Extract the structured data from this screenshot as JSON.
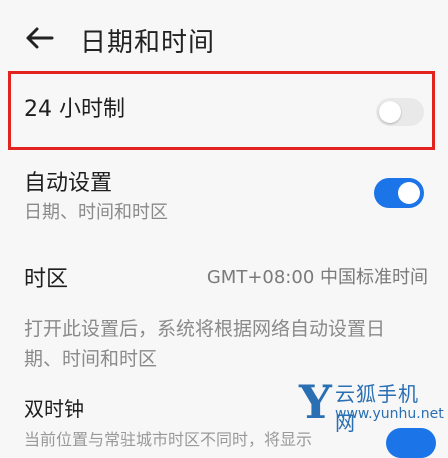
{
  "header": {
    "title": "日期和时间"
  },
  "settings": {
    "time_format_24h": {
      "label": "24 小时制",
      "enabled": false
    },
    "auto_set": {
      "label": "自动设置",
      "sublabel": "日期、时间和时区",
      "enabled": true
    },
    "time_zone": {
      "label": "时区",
      "value": "GMT+08:00 中国标准时间"
    },
    "note": "打开此设置后，系统将根据网络自动设置日期、时间和时区",
    "dual_clock": {
      "label": "双时钟",
      "sublabel": "当前位置与常驻城市时区不同时，将显示"
    }
  },
  "watermark": {
    "letter": "Y",
    "text": "云狐手机网",
    "url": "www.yunhu.net"
  },
  "colors": {
    "accent": "#1b74e8",
    "highlight_border": "#e2231f",
    "background": "#f7f7f7"
  }
}
